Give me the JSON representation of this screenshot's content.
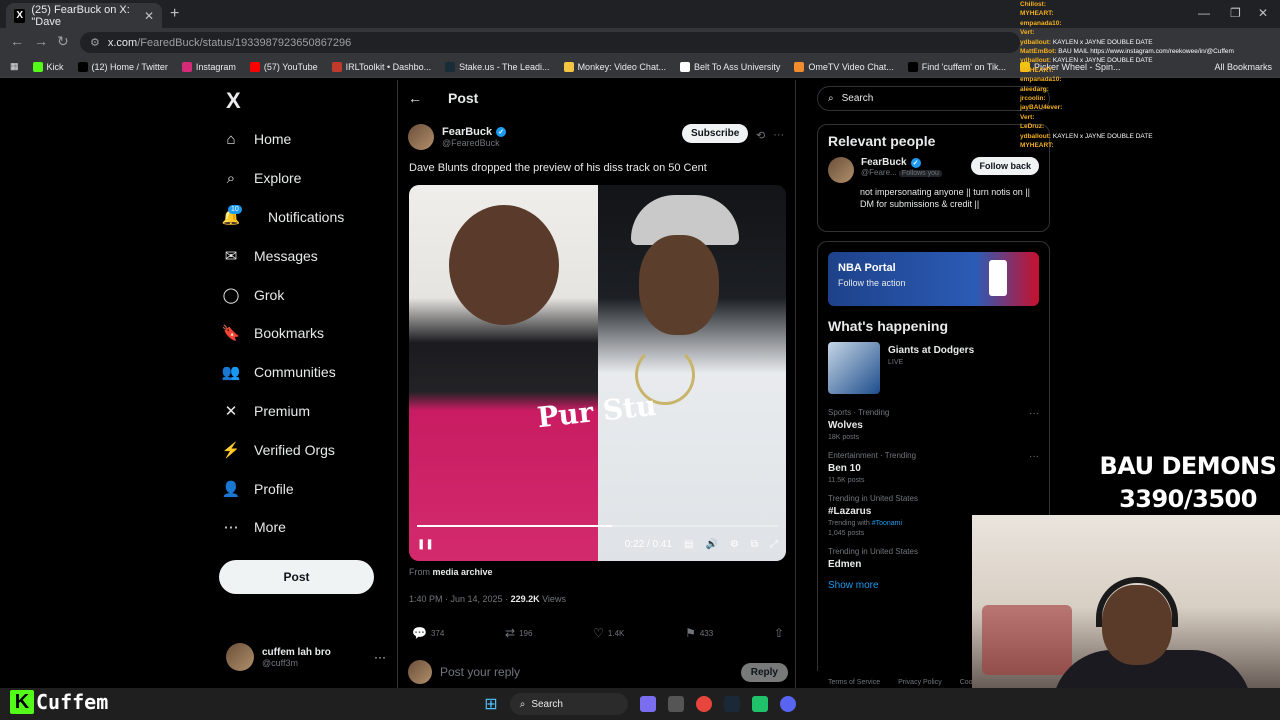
{
  "browser": {
    "tab_title": "(25) FearBuck on X: \"Dave",
    "url_host": "x.com",
    "url_path": "/FearedBuck/status/1933987923650867296",
    "bookmarks": [
      {
        "label": "Kick",
        "color": "#53fc18"
      },
      {
        "label": "(12) Home / Twitter",
        "color": "#000000"
      },
      {
        "label": "Instagram",
        "color": "#d62976"
      },
      {
        "label": "(57) YouTube",
        "color": "#ff0000"
      },
      {
        "label": "IRLToolkit • Dashbo...",
        "color": "#c0392b"
      },
      {
        "label": "Stake.us - The Leadi...",
        "color": "#1a2c38"
      },
      {
        "label": "Monkey: Video Chat...",
        "color": "#f5c542"
      },
      {
        "label": "Belt To Ass University",
        "color": "#ffffff"
      },
      {
        "label": "OmeTV Video Chat...",
        "color": "#f08c2b"
      },
      {
        "label": "Find 'cuffem' on Tik...",
        "color": "#000000"
      },
      {
        "label": "Picker Wheel - Spin...",
        "color": "#f1c40f"
      }
    ],
    "all_bookmarks": "All Bookmarks"
  },
  "nav": {
    "logo": "X",
    "items": [
      {
        "label": "Home",
        "icon": "⌂"
      },
      {
        "label": "Explore",
        "icon": "⌕"
      },
      {
        "label": "Notifications",
        "icon": "🔔"
      },
      {
        "label": "Messages",
        "icon": "✉"
      },
      {
        "label": "Grok",
        "icon": "◯"
      },
      {
        "label": "Bookmarks",
        "icon": "🔖"
      },
      {
        "label": "Communities",
        "icon": "👥"
      },
      {
        "label": "Premium",
        "icon": "✕"
      },
      {
        "label": "Verified Orgs",
        "icon": "⚡"
      },
      {
        "label": "Profile",
        "icon": "👤"
      },
      {
        "label": "More",
        "icon": "⋯"
      }
    ],
    "notif_badge": "10",
    "post_label": "Post",
    "me_name": "cuffem lah bro",
    "me_handle": "@cuff3m"
  },
  "post": {
    "header": "Post",
    "author_name": "FearBuck",
    "author_handle": "@FearedBuck",
    "subscribe": "Subscribe",
    "text": "Dave Blunts dropped the preview of his diss track on 50 Cent",
    "shirt_text": "Pur Stu",
    "video_time": "0:22 / 0:41",
    "video_progress": 0.54,
    "from_label": "From",
    "from_source": "media archive",
    "timestamp": "1:40 PM · Jun 14, 2025 · ",
    "views_count": "229.2K",
    "views_label": " Views",
    "replies": "374",
    "reposts": "196",
    "likes": "1.4K",
    "bookmarks": "433",
    "reply_placeholder": "Post your reply",
    "reply_button": "Reply"
  },
  "sidebar": {
    "search_placeholder": "Search",
    "relevant_title": "Relevant people",
    "rp_name": "FearBuck",
    "rp_handle": "@Feare...",
    "rp_follows_you": "Follows you",
    "rp_follow_back": "Follow back",
    "rp_bio": "not impersonating anyone || turn notis on || DM for submissions & credit ||",
    "nba_title": "NBA Portal",
    "nba_sub": "Follow the action",
    "happening_title": "What's happening",
    "live_event": "Giants at Dodgers",
    "live_label": "LIVE",
    "trends": [
      {
        "meta": "Sports · Trending",
        "name": "Wolves",
        "count": "18K posts"
      },
      {
        "meta": "Entertainment · Trending",
        "name": "Ben 10",
        "count": "11.5K posts"
      },
      {
        "meta": "Trending in United States",
        "name": "#Lazarus",
        "count": "1,045 posts",
        "with_prefix": "Trending with ",
        "with_tag": "#Toonami"
      },
      {
        "meta": "Trending in United States",
        "name": "Edmen",
        "count": ""
      }
    ],
    "show_more": "Show more",
    "footer": [
      "Terms of Service",
      "Privacy Policy",
      "Coo"
    ]
  },
  "stream": {
    "chat": [
      {
        "user": "Chillost:",
        "msg": ""
      },
      {
        "user": "MYHEART:",
        "msg": ""
      },
      {
        "user": "empanada10:",
        "msg": ""
      },
      {
        "user": "Vert:",
        "msg": ""
      },
      {
        "user": "ydballout:",
        "msg": "KAYLEN x JAYNE DOUBLE DATE"
      },
      {
        "user": "MattEmBot:",
        "msg": "BAU MAIL https://www.instagram.com/reekowee/in/@Cuffem"
      },
      {
        "user": "ydballout:",
        "msg": "KAYLEN x JAYNE DOUBLE DATE"
      },
      {
        "user": "MYHEART:",
        "msg": ""
      },
      {
        "user": "empanada10:",
        "msg": ""
      },
      {
        "user": "aleedarg:",
        "msg": ""
      },
      {
        "user": "jrcoolin:",
        "msg": ""
      },
      {
        "user": "jayBAU4ever:",
        "msg": ""
      },
      {
        "user": "Vert:",
        "msg": ""
      },
      {
        "user": "LeDruz:",
        "msg": ""
      },
      {
        "user": "ydballout:",
        "msg": "KAYLEN x JAYNE DOUBLE DATE"
      },
      {
        "user": "MYHEART:",
        "msg": ""
      }
    ],
    "goal_title": "BAU DEMONS",
    "goal_count": "3390/3500",
    "brand_letter": "K",
    "brand_name": "Cuffem"
  },
  "taskbar": {
    "search": "Search"
  }
}
